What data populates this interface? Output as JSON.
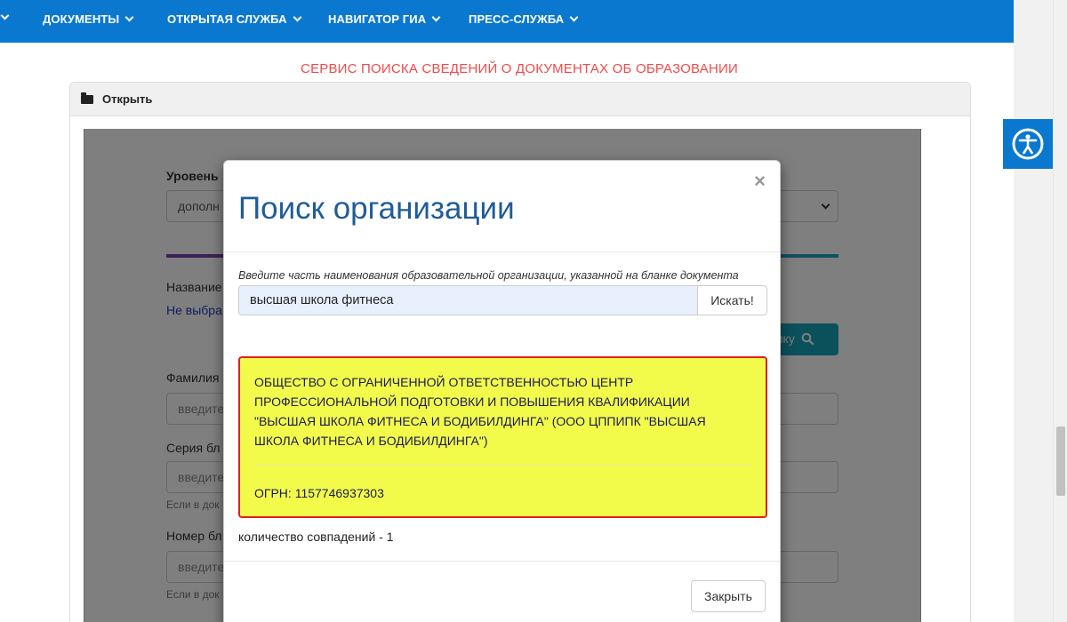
{
  "nav": {
    "items": [
      {
        "label": "ДОКУМЕНТЫ"
      },
      {
        "label": "ОТКРЫТАЯ СЛУЖБА"
      },
      {
        "label": "НАВИГАТОР ГИА"
      },
      {
        "label": "ПРЕСС-СЛУЖБА"
      }
    ]
  },
  "page": {
    "title": "СЕРВИС ПОИСКА СВЕДЕНИЙ О ДОКУМЕНТАХ ОБ ОБРАЗОВАНИИ"
  },
  "panel": {
    "header": "Открыть"
  },
  "form": {
    "level_label": "Уровень",
    "level_value": "дополн",
    "name_label": "Название",
    "name_link": "Не выбра",
    "search_btn_label": "нику",
    "surname_label": "Фамилия",
    "surname_placeholder": "введите",
    "series_label": "Серия бл",
    "series_placeholder": "введите",
    "series_hint": "Если в док",
    "number_label": "Номер бл",
    "number_placeholder": "введите",
    "number_hint": "Если в док"
  },
  "modal": {
    "title": "Поиск организации",
    "close_glyph": "×",
    "hint": "Введите часть наименования образовательной организации, указанной на бланке документа",
    "search_value": "высшая школа фитнеса",
    "search_button": "Искать!",
    "result": {
      "name": "ОБЩЕСТВО С ОГРАНИЧЕННОЙ ОТВЕТСТВЕННОСТЬЮ ЦЕНТР ПРОФЕССИОНАЛЬНОЙ ПОДГОТОВКИ И ПОВЫШЕНИЯ КВАЛИФИКАЦИИ \"ВЫСШАЯ ШКОЛА ФИТНЕСА И БОДИБИЛДИНГА\" (ООО ЦППИПК \"ВЫСШАЯ ШКОЛА ФИТНЕСА И БОДИБИЛДИНГА\")",
      "ogrn": "ОГРН: 1157746937303"
    },
    "match_count": "количество совпадений - 1",
    "close_button": "Закрыть"
  },
  "colors": {
    "nav_bg": "#0b78d0",
    "title_red": "#ef4b4b",
    "modal_title_blue": "#1f5c99",
    "result_bg": "#f3fb4a",
    "result_border": "#e02020"
  },
  "icons": {
    "panel": "folder-open-icon",
    "accessibility": "accessibility-icon",
    "search": "search-icon"
  }
}
